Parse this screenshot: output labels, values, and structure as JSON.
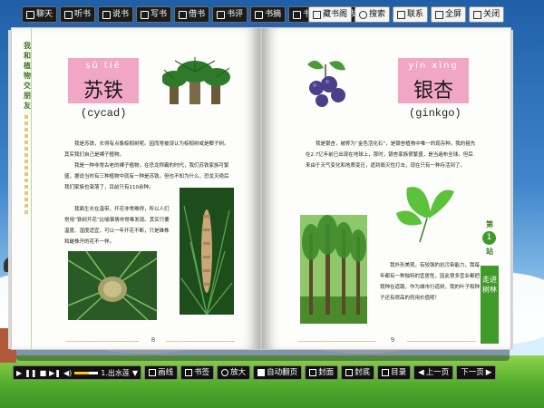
{
  "top_toolbar": [
    {
      "label": "聊天",
      "icon": "chat-icon"
    },
    {
      "label": "听书",
      "icon": "headphones-icon"
    },
    {
      "label": "说书",
      "icon": "speaker-icon"
    },
    {
      "label": "写书",
      "icon": "pen-icon"
    },
    {
      "label": "借书",
      "icon": "book-icon"
    },
    {
      "label": "书评",
      "icon": "comment-icon"
    },
    {
      "label": "书摘",
      "icon": "excerpt-icon"
    },
    {
      "label": "书讯",
      "icon": "news-icon"
    },
    {
      "label": "书友",
      "icon": "friends-icon"
    }
  ],
  "top_right_toolbar": [
    {
      "label": "藏书阁",
      "icon": "library-icon"
    },
    {
      "label": "搜索",
      "icon": "search-icon"
    },
    {
      "label": "联系",
      "icon": "mail-icon"
    },
    {
      "label": "全屏",
      "icon": "fullscreen-icon"
    },
    {
      "label": "关闭",
      "icon": "close-icon"
    }
  ],
  "left_page": {
    "side_title": "我和植物交朋友",
    "pinyin": "sū tiě",
    "hanzi": "苏铁",
    "english": "(cycad)",
    "paragraphs": [
      "我是苏铁，长得有点像棕榈树呢。因而常被误认为棕榈树或是椰子树。其实我们自己是裸子植物。",
      "我是一种非常古老的裸子植物，在恐龙称霸的时代，我们苏铁家族可繁盛，据说当时有三种植物中就有一种是苏铁。但也不知为什么，恐龙灭绝后我们家族也衰落了，目前只有110余种。",
      "我面生长在温带，开花非常难得，所以人们常用“铁树开花”比喻事情非常难发现。其实只要温度、湿度适宜，可以一年开花不断，只是雄株和雌株开的花不一样。"
    ],
    "page_number": "8"
  },
  "right_page": {
    "pinyin": "yín xìng",
    "hanzi": "银杏",
    "english": "(ginkgo)",
    "paragraphs": [
      "我是银杏，被称为“金色活化石”，是银杏植物中唯一的现存种。我的祖先在2.7亿年前已出现在地球上，那时，银杏家族很繁盛，是当遍布全球。但后来由于天气变化和地质变迁，遗到毁灭性打击，现在只有一种存活到了。",
      "我外形美观，有较强的抗污染能力，我每年都有一种独特的宜居性，因此很多宜业都把我种在道路，作为城市行道树，我的叶子和种子还有很高的药用价值呢！"
    ],
    "chapter_label": "第",
    "chapter_number": "1",
    "chapter_suffix": "站",
    "section_tab": "走进树林",
    "page_number": "9"
  },
  "bottom_bar": {
    "media_label": "1.出水莲",
    "volume": 0.6,
    "buttons": [
      {
        "label": "画线",
        "icon": "pen-icon"
      },
      {
        "label": "书签",
        "icon": "bookmark-icon"
      },
      {
        "label": "放大",
        "icon": "zoom-in-icon"
      },
      {
        "label": "自动翻页",
        "icon": "checkbox-icon"
      },
      {
        "label": "封面",
        "icon": "cover-icon"
      },
      {
        "label": "封底",
        "icon": "back-cover-icon"
      },
      {
        "label": "目录",
        "icon": "toc-icon"
      },
      {
        "label": "上一页",
        "icon": "prev-icon"
      },
      {
        "label": "下一页",
        "icon": "next-icon"
      }
    ]
  }
}
